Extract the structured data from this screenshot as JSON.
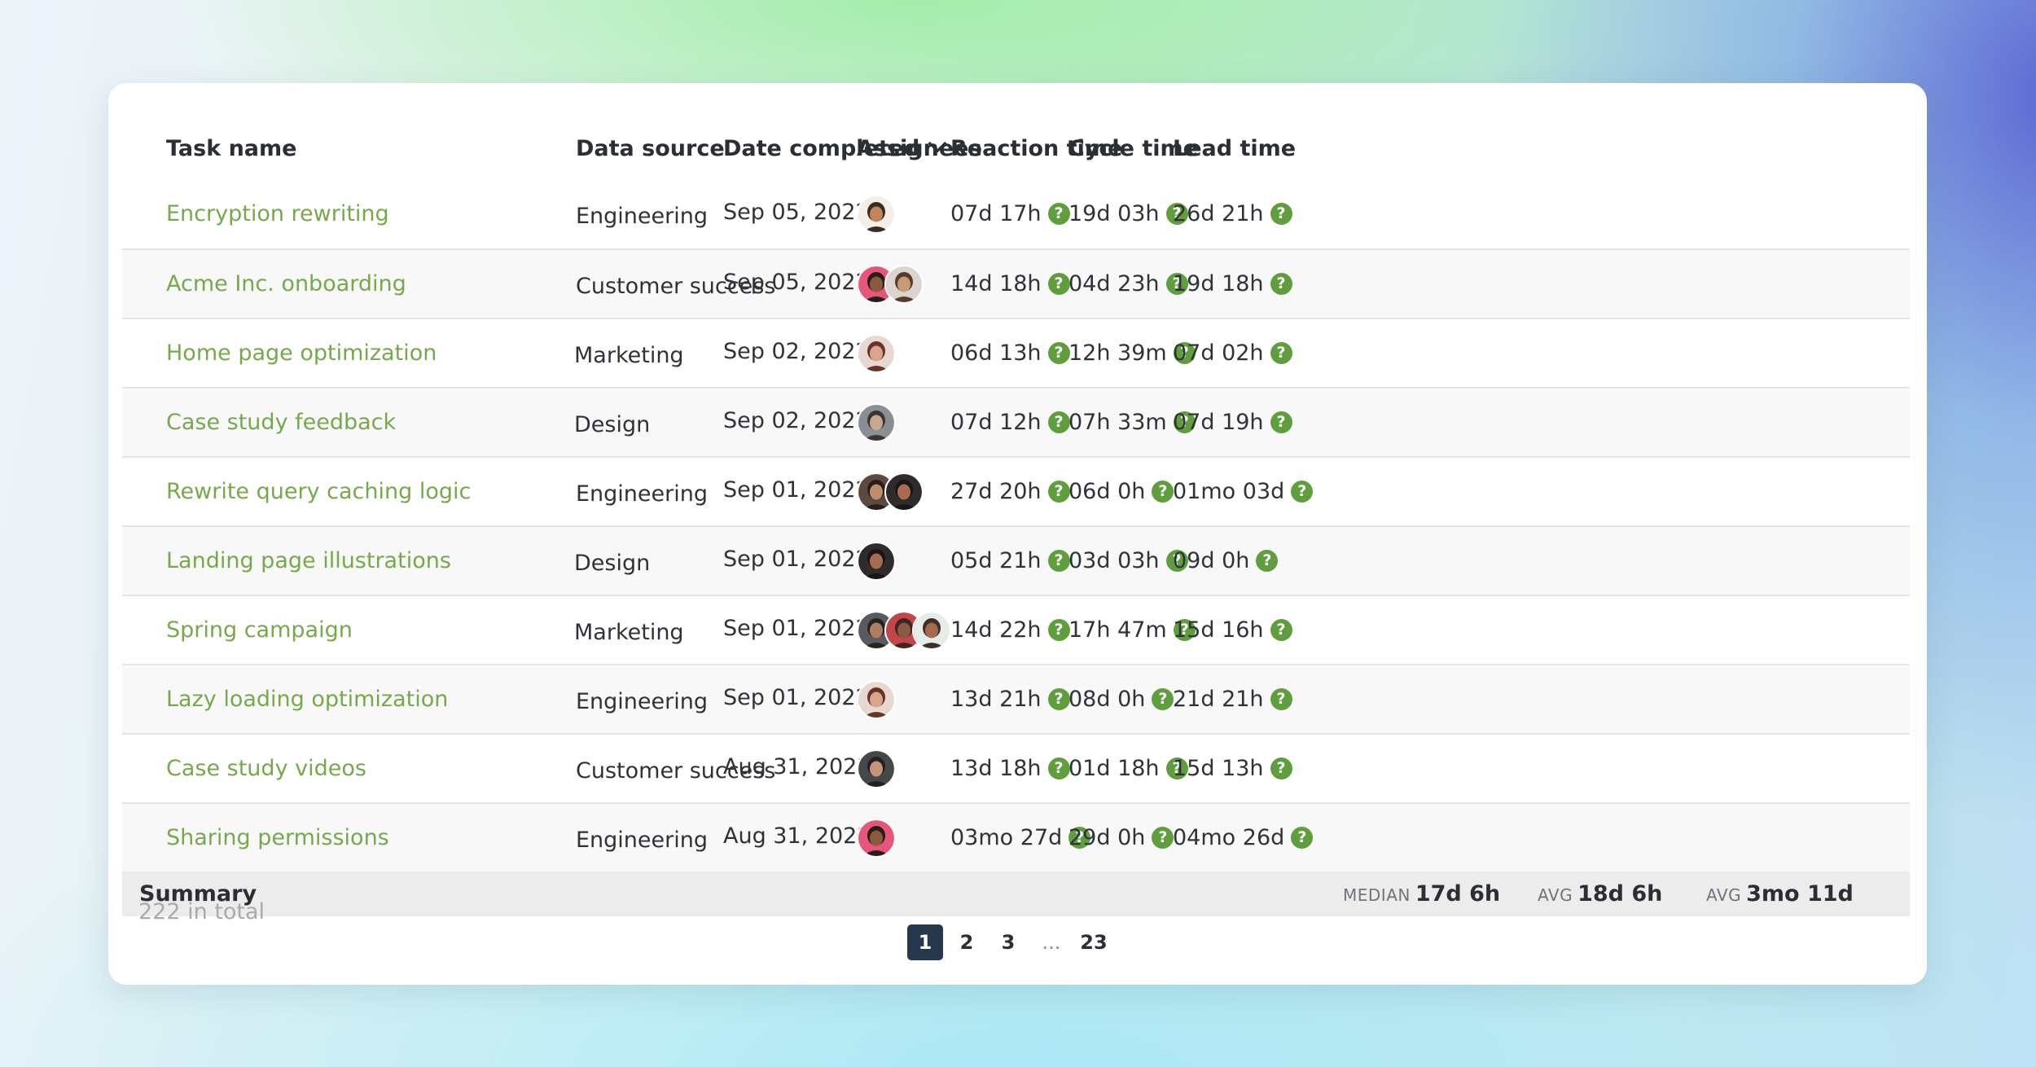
{
  "table": {
    "headers": {
      "task": "Task name",
      "source": "Data source",
      "date": "Date completed",
      "assignees": "Assignees",
      "reaction": "Reaction time",
      "cycle": "Cycle time",
      "lead": "Lead time"
    },
    "sort_icon": "chevron-down-icon",
    "help_icon": "question-circle-icon",
    "help_glyph": "?",
    "rows": [
      {
        "task": "Encryption rewriting",
        "source": "Engineering",
        "date": "Sep 05, 2022",
        "assignees": [
          "avatar-1"
        ],
        "reaction": "07d 17h",
        "cycle": "19d 03h",
        "lead": "26d 21h"
      },
      {
        "task": "Acme Inc. onboarding",
        "source": "Customer success",
        "date": "Sep 05, 2022",
        "assignees": [
          "avatar-2",
          "avatar-3"
        ],
        "reaction": "14d 18h",
        "cycle": "04d 23h",
        "lead": "19d 18h"
      },
      {
        "task": "Home page optimization",
        "source": "Marketing",
        "date": "Sep 02, 2022",
        "assignees": [
          "avatar-4"
        ],
        "reaction": "06d 13h",
        "cycle": "12h 39m",
        "lead": "07d 02h"
      },
      {
        "task": "Case study feedback",
        "source": "Design",
        "date": "Sep 02, 2022",
        "assignees": [
          "avatar-5"
        ],
        "reaction": "07d 12h",
        "cycle": "07h 33m",
        "lead": "07d 19h"
      },
      {
        "task": "Rewrite query caching logic",
        "source": "Engineering",
        "date": "Sep 01, 2022",
        "assignees": [
          "avatar-6",
          "avatar-7"
        ],
        "reaction": "27d 20h",
        "cycle": "06d 0h",
        "lead": "01mo 03d"
      },
      {
        "task": "Landing page illustrations",
        "source": "Design",
        "date": "Sep 01, 2022",
        "assignees": [
          "avatar-7"
        ],
        "reaction": "05d 21h",
        "cycle": "03d 03h",
        "lead": "09d 0h"
      },
      {
        "task": "Spring campaign",
        "source": "Marketing",
        "date": "Sep 01, 2022",
        "assignees": [
          "avatar-8",
          "avatar-9",
          "avatar-10"
        ],
        "reaction": "14d 22h",
        "cycle": "17h 47m",
        "lead": "15d 16h"
      },
      {
        "task": "Lazy loading optimization",
        "source": "Engineering",
        "date": "Sep 01, 2022",
        "assignees": [
          "avatar-4"
        ],
        "reaction": "13d 21h",
        "cycle": "08d 0h",
        "lead": "21d 21h"
      },
      {
        "task": "Case study videos",
        "source": "Customer success",
        "date": "Aug 31, 2022",
        "assignees": [
          "avatar-11"
        ],
        "reaction": "13d 18h",
        "cycle": "01d 18h",
        "lead": "15d 13h"
      },
      {
        "task": "Sharing permissions",
        "source": "Engineering",
        "date": "Aug 31, 2022",
        "assignees": [
          "avatar-2"
        ],
        "reaction": "03mo 27d",
        "cycle": "29d 0h",
        "lead": "04mo 26d"
      }
    ]
  },
  "summary": {
    "label": "Summary",
    "reaction": {
      "kind": "MEDIAN",
      "value": "17d 6h"
    },
    "cycle": {
      "kind": "AVG",
      "value": "18d 6h"
    },
    "lead": {
      "kind": "AVG",
      "value": "3mo 11d"
    }
  },
  "total_text": "222 in total",
  "pagination": {
    "pages": [
      "1",
      "2",
      "3",
      "...",
      "23"
    ],
    "current": "1"
  },
  "colors": {
    "task_link": "#76a94a",
    "help_icon": "#5f9e3c",
    "active_page": "#26384b",
    "summary_bg": "#ececed"
  }
}
